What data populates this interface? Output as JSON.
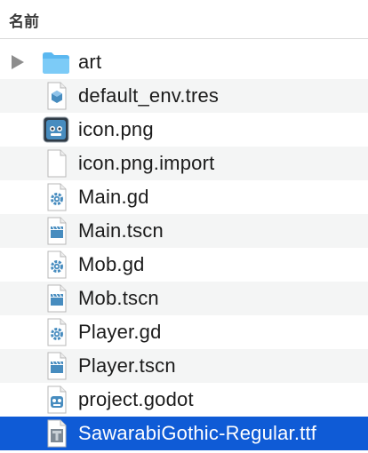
{
  "header": {
    "name_column": "名前"
  },
  "files": [
    {
      "name": "art",
      "icon": "folder-icon",
      "expandable": true
    },
    {
      "name": "default_env.tres",
      "icon": "godot-resource-icon"
    },
    {
      "name": "icon.png",
      "icon": "godot-image-icon"
    },
    {
      "name": "icon.png.import",
      "icon": "blank-document-icon"
    },
    {
      "name": "Main.gd",
      "icon": "gdscript-gear-icon"
    },
    {
      "name": "Main.tscn",
      "icon": "godot-scene-icon"
    },
    {
      "name": "Mob.gd",
      "icon": "gdscript-gear-icon"
    },
    {
      "name": "Mob.tscn",
      "icon": "godot-scene-icon"
    },
    {
      "name": "Player.gd",
      "icon": "gdscript-gear-icon"
    },
    {
      "name": "Player.tscn",
      "icon": "godot-scene-icon"
    },
    {
      "name": "project.godot",
      "icon": "godot-project-icon"
    },
    {
      "name": "SawarabiGothic-Regular.ttf",
      "icon": "font-file-icon",
      "selected": true
    }
  ],
  "colors": {
    "selection": "#0f5bd6",
    "folder": "#6cc3f5",
    "godot_blue": "#478cbf"
  }
}
